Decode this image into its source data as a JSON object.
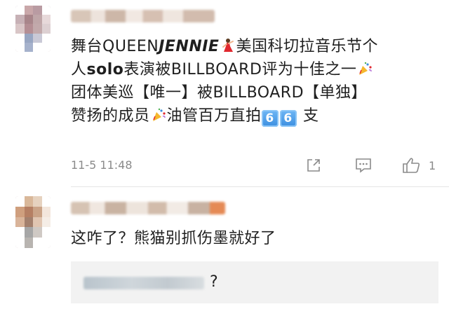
{
  "comments": [
    {
      "text_parts": {
        "p1": "舞台QUEEN",
        "p2": "JENNIE",
        "p3": "美国科切拉音乐节个",
        "p4": "人",
        "p5": "solo",
        "p6": "表演被BILLBOARD评为十佳之一",
        "p7": "团体美巡【唯一】被BILLBOARD【单独】",
        "p8": "赞扬的成员",
        "p9": "油管百万直拍",
        "p10": "6",
        "p11": "6",
        "p12": " 支"
      },
      "emojis": [
        "dancer-emoji",
        "party-popper-emoji",
        "party-popper-emoji",
        "keycap-6-emoji",
        "keycap-6-emoji"
      ],
      "timestamp": "11-5 11:48",
      "actions": {
        "like_count": "1"
      }
    },
    {
      "text": "这咋了？熊猫别抓伤墨就好了",
      "reply": {
        "text": "?"
      }
    }
  ],
  "colors": {
    "text": "#1f1f1f",
    "meta": "#8a8a8a",
    "divider": "#e6e6e6",
    "reply_bg": "#f2f2f2",
    "keycap": "#3d8fe0"
  }
}
